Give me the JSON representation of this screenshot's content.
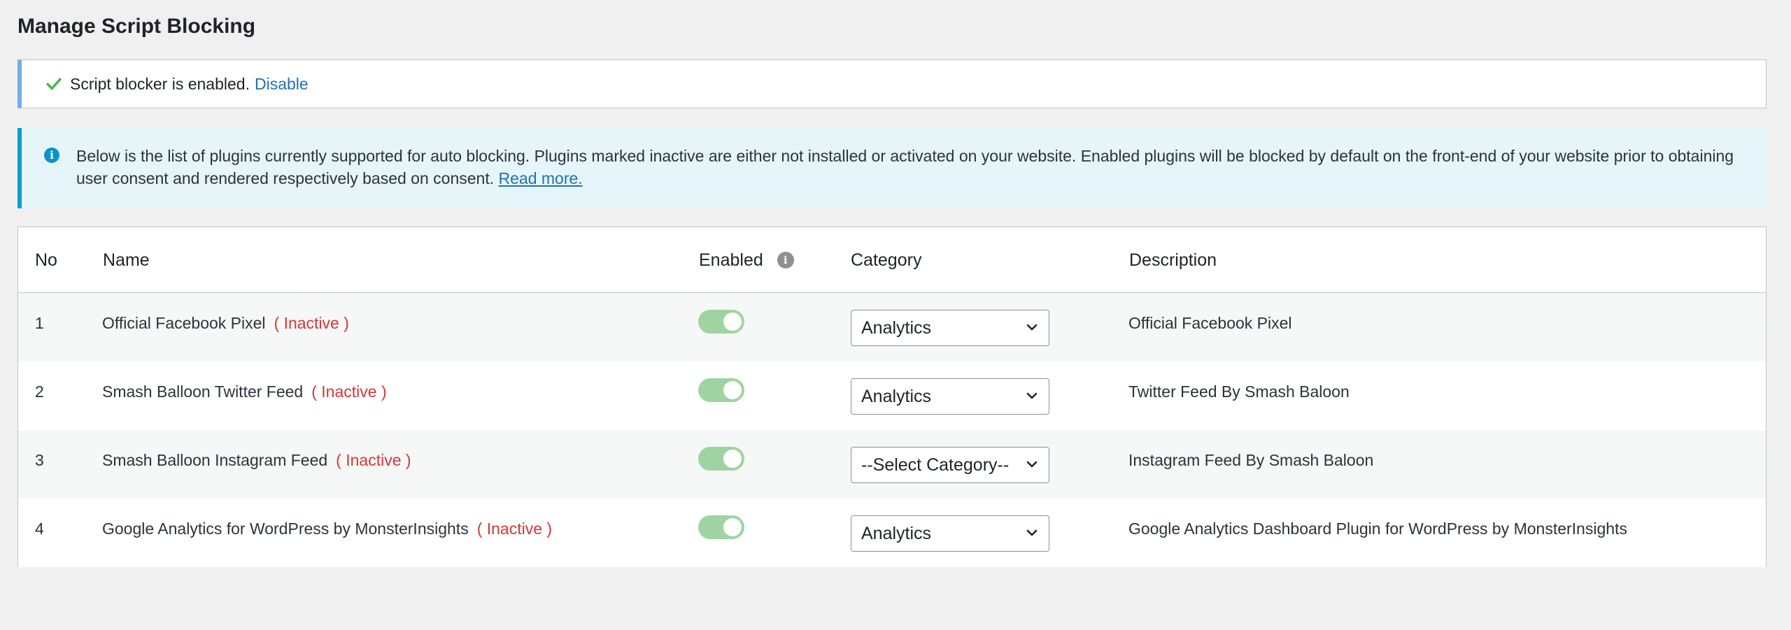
{
  "page": {
    "title": "Manage Script Blocking"
  },
  "success_notice": {
    "icon": "checkmark-icon",
    "text": "Script blocker is enabled.",
    "link_label": "Disable",
    "color": "#46b450"
  },
  "info_notice": {
    "icon": "info-icon",
    "text": "Below is the list of plugins currently supported for auto blocking. Plugins marked inactive are either not installed or activated on your website. Enabled plugins will be blocked by default on the front-end of your website prior to obtaining user consent and rendered respectively based on consent.",
    "link_label": "Read more."
  },
  "table": {
    "columns": {
      "no": "No",
      "name": "Name",
      "enabled": "Enabled",
      "enabled_info_icon": "info-icon",
      "category": "Category",
      "description": "Description"
    },
    "rows": [
      {
        "no": "1",
        "name": "Official Facebook Pixel",
        "status": "( Inactive )",
        "enabled": true,
        "category": "Analytics",
        "description": "Official Facebook Pixel"
      },
      {
        "no": "2",
        "name": "Smash Balloon Twitter Feed",
        "status": "( Inactive )",
        "enabled": true,
        "category": "Analytics",
        "description": "Twitter Feed By Smash Baloon"
      },
      {
        "no": "3",
        "name": "Smash Balloon Instagram Feed",
        "status": "( Inactive )",
        "enabled": true,
        "category": "--Select Category--",
        "description": "Instagram Feed By Smash Baloon"
      },
      {
        "no": "4",
        "name": "Google Analytics for WordPress by MonsterInsights",
        "status": "( Inactive )",
        "enabled": true,
        "category": "Analytics",
        "description": "Google Analytics Dashboard Plugin for WordPress by MonsterInsights"
      }
    ]
  },
  "colors": {
    "inactive": "#d63638",
    "link": "#2271b1",
    "toggle_on": "#9fd4a2",
    "info_border": "#00a0d2",
    "success_border": "#72aee6"
  }
}
